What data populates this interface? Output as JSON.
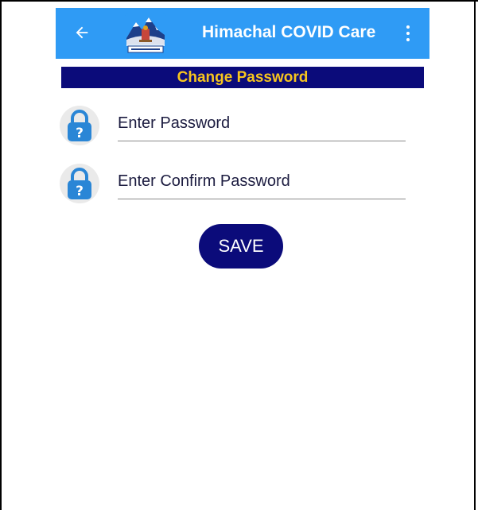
{
  "appbar": {
    "title": "Himachal COVID Care",
    "back_icon": "arrow-left-icon",
    "menu_icon": "more-vertical-icon",
    "logo": "himachal-government-emblem",
    "background_color": "#2f9bf5"
  },
  "section": {
    "title": "Change Password",
    "background_color": "#0b0b7a",
    "text_color": "#f7c51e"
  },
  "form": {
    "password": {
      "placeholder": "Enter Password",
      "value": "",
      "icon": "lock-question-icon"
    },
    "confirm_password": {
      "placeholder": "Enter Confirm Password",
      "value": "",
      "icon": "lock-question-icon"
    },
    "save_label": "SAVE",
    "save_color": "#0b0b7a"
  }
}
